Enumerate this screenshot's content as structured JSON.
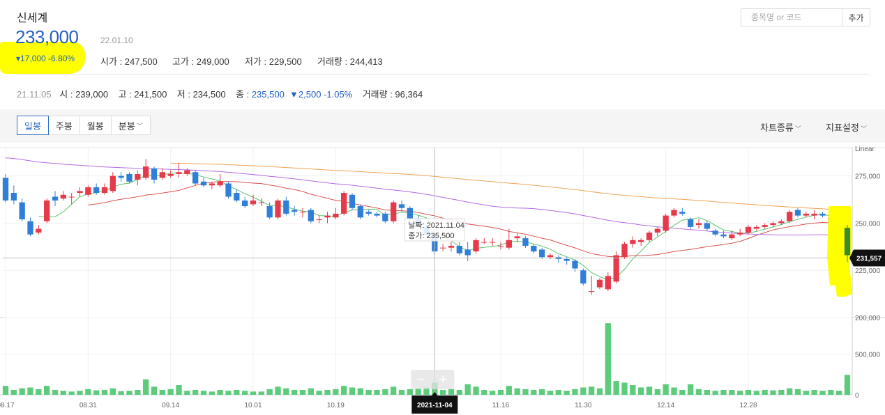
{
  "header": {
    "stock_name": "신세계",
    "price": "233,000",
    "price_date": "22.01.10",
    "change": "▾17,000 -6.80%",
    "open_label": "시가 : ",
    "open_value": "247,500",
    "high_label": "고가 : ",
    "high_value": "249,000",
    "low_label": "저가 : ",
    "low_value": "229,500",
    "volume_label": "거래량 : ",
    "volume_value": "244,413"
  },
  "search": {
    "placeholder": "종목명 or 코드",
    "add_label": "추가"
  },
  "prev_row": {
    "date": "21.11.05",
    "open_label": "시 : ",
    "open_value": "239,000",
    "high_label": "고 : ",
    "high_value": "241,500",
    "low_label": "저 : ",
    "low_value": "234,500",
    "close_label": "종 : ",
    "close_value": "235,500",
    "change": "▼2,500 -1.05%",
    "volume_label": "거래량 : ",
    "volume_value": "96,364"
  },
  "toolbar": {
    "tabs": [
      {
        "label": "일봉",
        "active": true
      },
      {
        "label": "주봉",
        "active": false
      },
      {
        "label": "월봉",
        "active": false
      },
      {
        "label": "분봉",
        "active": false,
        "dropdown": true
      }
    ],
    "chart_type_label": "차트종류",
    "indicator_label": "지표설정"
  },
  "colors": {
    "up": "#e63a4a",
    "down": "#2f7ed8",
    "volume": "#5ccc7c",
    "ma5": "#5cc46e",
    "ma20": "#d9534f",
    "ma60": "#b36ae0",
    "ma120": "#f0a356",
    "accent": "#2361c2",
    "highlight": "#ffff00",
    "last_candle": "#3a8a2f"
  },
  "chart_data": {
    "type": "candlestick",
    "scale_label": "Linear",
    "price_ticks": [
      "275,000",
      "250,000",
      "225,000",
      "200,000"
    ],
    "price_tick_values": [
      275000,
      250000,
      225000,
      200000
    ],
    "volume_ticks": [
      "500,000",
      "0"
    ],
    "volume_tick_values": [
      500000,
      0
    ],
    "x_ticks": [
      {
        "label": "08.17",
        "index": 0
      },
      {
        "label": "08.31",
        "index": 10
      },
      {
        "label": "09.14",
        "index": 20
      },
      {
        "label": "10.01",
        "index": 30
      },
      {
        "label": "10.19",
        "index": 40
      },
      {
        "label": "11.16",
        "index": 60
      },
      {
        "label": "11.30",
        "index": 70
      },
      {
        "label": "12.14",
        "index": 80
      },
      {
        "label": "12.28",
        "index": 90
      }
    ],
    "current_price_label": "231,557",
    "current_price_value": 231557,
    "crosshair": {
      "index": 52,
      "date_label": "2021-11-04",
      "tooltip_date": "날짜: 2021.11.04",
      "tooltip_close": "종가: 235,500"
    },
    "candles": [
      {
        "o": 274000,
        "c": 262000,
        "h": 276000,
        "l": 261000,
        "v": 110000
      },
      {
        "o": 266000,
        "c": 262000,
        "h": 270000,
        "l": 260000,
        "v": 60000
      },
      {
        "o": 261000,
        "c": 252000,
        "h": 263000,
        "l": 251000,
        "v": 80000
      },
      {
        "o": 251000,
        "c": 244000,
        "h": 253000,
        "l": 243000,
        "v": 90000
      },
      {
        "o": 245000,
        "c": 247000,
        "h": 249000,
        "l": 244000,
        "v": 70000
      },
      {
        "o": 251000,
        "c": 262000,
        "h": 263000,
        "l": 250000,
        "v": 110000
      },
      {
        "o": 264000,
        "c": 262000,
        "h": 267000,
        "l": 259000,
        "v": 60000
      },
      {
        "o": 263000,
        "c": 265000,
        "h": 267000,
        "l": 262000,
        "v": 50000
      },
      {
        "o": 264000,
        "c": 264000,
        "h": 266000,
        "l": 260000,
        "v": 40000
      },
      {
        "o": 266000,
        "c": 267000,
        "h": 269000,
        "l": 264000,
        "v": 50000
      },
      {
        "o": 265000,
        "c": 269000,
        "h": 270000,
        "l": 264000,
        "v": 70000
      },
      {
        "o": 269000,
        "c": 266000,
        "h": 271000,
        "l": 265000,
        "v": 55000
      },
      {
        "o": 266000,
        "c": 269000,
        "h": 271000,
        "l": 265000,
        "v": 60000
      },
      {
        "o": 267000,
        "c": 275000,
        "h": 277000,
        "l": 266000,
        "v": 80000
      },
      {
        "o": 275000,
        "c": 274000,
        "h": 277000,
        "l": 272000,
        "v": 45000
      },
      {
        "o": 276000,
        "c": 272000,
        "h": 277000,
        "l": 271000,
        "v": 50000
      },
      {
        "o": 273000,
        "c": 276000,
        "h": 278000,
        "l": 270000,
        "v": 60000
      },
      {
        "o": 274000,
        "c": 280000,
        "h": 284000,
        "l": 273000,
        "v": 190000
      },
      {
        "o": 279000,
        "c": 273000,
        "h": 280000,
        "l": 271000,
        "v": 100000
      },
      {
        "o": 274000,
        "c": 277000,
        "h": 279000,
        "l": 273000,
        "v": 60000
      },
      {
        "o": 275000,
        "c": 276000,
        "h": 278000,
        "l": 274000,
        "v": 70000
      },
      {
        "o": 276000,
        "c": 277000,
        "h": 282000,
        "l": 274000,
        "v": 120000
      },
      {
        "o": 276000,
        "c": 278000,
        "h": 279000,
        "l": 275000,
        "v": 50000
      },
      {
        "o": 277000,
        "c": 271000,
        "h": 278000,
        "l": 270000,
        "v": 60000
      },
      {
        "o": 272000,
        "c": 270000,
        "h": 274000,
        "l": 269000,
        "v": 50000
      },
      {
        "o": 270000,
        "c": 271000,
        "h": 272000,
        "l": 268000,
        "v": 40000
      },
      {
        "o": 270000,
        "c": 272000,
        "h": 276000,
        "l": 269000,
        "v": 60000
      },
      {
        "o": 271000,
        "c": 264000,
        "h": 272000,
        "l": 263000,
        "v": 50000
      },
      {
        "o": 266000,
        "c": 262000,
        "h": 268000,
        "l": 261000,
        "v": 60000
      },
      {
        "o": 262000,
        "c": 259000,
        "h": 264000,
        "l": 258000,
        "v": 50000
      },
      {
        "o": 260000,
        "c": 262000,
        "h": 265000,
        "l": 259000,
        "v": 40000
      },
      {
        "o": 261000,
        "c": 261000,
        "h": 263000,
        "l": 259000,
        "v": 40000
      },
      {
        "o": 259000,
        "c": 253000,
        "h": 261000,
        "l": 252000,
        "v": 70000
      },
      {
        "o": 253000,
        "c": 262000,
        "h": 263000,
        "l": 252000,
        "v": 100000
      },
      {
        "o": 262000,
        "c": 255000,
        "h": 264000,
        "l": 254000,
        "v": 80000
      },
      {
        "o": 257000,
        "c": 256000,
        "h": 259000,
        "l": 254000,
        "v": 60000
      },
      {
        "o": 256000,
        "c": 256000,
        "h": 258000,
        "l": 253000,
        "v": 60000
      },
      {
        "o": 257000,
        "c": 251000,
        "h": 258000,
        "l": 250000,
        "v": 80000
      },
      {
        "o": 252000,
        "c": 252000,
        "h": 254000,
        "l": 250000,
        "v": 50000
      },
      {
        "o": 253000,
        "c": 254000,
        "h": 256000,
        "l": 250000,
        "v": 60000
      },
      {
        "o": 253000,
        "c": 255000,
        "h": 258000,
        "l": 252000,
        "v": 70000
      },
      {
        "o": 255000,
        "c": 266000,
        "h": 267000,
        "l": 254000,
        "v": 110000
      },
      {
        "o": 265000,
        "c": 258000,
        "h": 266000,
        "l": 257000,
        "v": 90000
      },
      {
        "o": 259000,
        "c": 253000,
        "h": 260000,
        "l": 252000,
        "v": 80000
      },
      {
        "o": 256000,
        "c": 255000,
        "h": 257000,
        "l": 254000,
        "v": 60000
      },
      {
        "o": 255000,
        "c": 254000,
        "h": 256000,
        "l": 253000,
        "v": 60000
      },
      {
        "o": 255000,
        "c": 251000,
        "h": 256000,
        "l": 250000,
        "v": 70000
      },
      {
        "o": 251000,
        "c": 261000,
        "h": 262000,
        "l": 250000,
        "v": 100000
      },
      {
        "o": 260000,
        "c": 258000,
        "h": 262000,
        "l": 256000,
        "v": 60000
      },
      {
        "o": 258000,
        "c": 252000,
        "h": 259000,
        "l": 251000,
        "v": 70000
      },
      {
        "o": 252000,
        "c": 249000,
        "h": 254000,
        "l": 248000,
        "v": 80000
      },
      {
        "o": 248000,
        "c": 244000,
        "h": 249000,
        "l": 243000,
        "v": 90000
      },
      {
        "o": 244000,
        "c": 235000,
        "h": 246000,
        "l": 233000,
        "v": 150000
      },
      {
        "o": 237000,
        "c": 237000,
        "h": 239000,
        "l": 235000,
        "v": 60000
      },
      {
        "o": 237000,
        "c": 238000,
        "h": 240000,
        "l": 235000,
        "v": 70000
      },
      {
        "o": 238000,
        "c": 234000,
        "h": 240000,
        "l": 233000,
        "v": 60000
      },
      {
        "o": 236000,
        "c": 233000,
        "h": 240000,
        "l": 230000,
        "v": 130000
      },
      {
        "o": 235000,
        "c": 241000,
        "h": 242000,
        "l": 234000,
        "v": 100000
      },
      {
        "o": 240000,
        "c": 240000,
        "h": 242000,
        "l": 239000,
        "v": 60000
      },
      {
        "o": 240000,
        "c": 240000,
        "h": 242000,
        "l": 238000,
        "v": 50000
      },
      {
        "o": 238000,
        "c": 238000,
        "h": 240000,
        "l": 236000,
        "v": 60000
      },
      {
        "o": 237000,
        "c": 241000,
        "h": 247000,
        "l": 236000,
        "v": 110000
      },
      {
        "o": 242000,
        "c": 243000,
        "h": 245000,
        "l": 240000,
        "v": 80000
      },
      {
        "o": 242000,
        "c": 238000,
        "h": 243000,
        "l": 237000,
        "v": 70000
      },
      {
        "o": 238000,
        "c": 235000,
        "h": 239000,
        "l": 234000,
        "v": 60000
      },
      {
        "o": 236000,
        "c": 232000,
        "h": 237000,
        "l": 231000,
        "v": 70000
      },
      {
        "o": 232000,
        "c": 233000,
        "h": 234000,
        "l": 231000,
        "v": 50000
      },
      {
        "o": 232000,
        "c": 231000,
        "h": 233000,
        "l": 229000,
        "v": 60000
      },
      {
        "o": 231000,
        "c": 230000,
        "h": 232000,
        "l": 228000,
        "v": 50000
      },
      {
        "o": 230000,
        "c": 226000,
        "h": 231000,
        "l": 224000,
        "v": 70000
      },
      {
        "o": 225000,
        "c": 218000,
        "h": 226000,
        "l": 217000,
        "v": 90000
      },
      {
        "o": 214000,
        "c": 214000,
        "h": 222000,
        "l": 212000,
        "v": 100000
      },
      {
        "o": 216000,
        "c": 220000,
        "h": 221000,
        "l": 215000,
        "v": 80000
      },
      {
        "o": 215000,
        "c": 222000,
        "h": 224000,
        "l": 214000,
        "v": 880000
      },
      {
        "o": 219000,
        "c": 233000,
        "h": 235000,
        "l": 218000,
        "v": 170000
      },
      {
        "o": 232000,
        "c": 239000,
        "h": 240000,
        "l": 231000,
        "v": 150000
      },
      {
        "o": 239000,
        "c": 241000,
        "h": 243000,
        "l": 237000,
        "v": 120000
      },
      {
        "o": 240000,
        "c": 241000,
        "h": 242000,
        "l": 238000,
        "v": 90000
      },
      {
        "o": 241000,
        "c": 245000,
        "h": 246000,
        "l": 240000,
        "v": 100000
      },
      {
        "o": 245000,
        "c": 247000,
        "h": 248000,
        "l": 243000,
        "v": 70000
      },
      {
        "o": 246000,
        "c": 254000,
        "h": 255000,
        "l": 245000,
        "v": 130000
      },
      {
        "o": 254000,
        "c": 257000,
        "h": 258000,
        "l": 253000,
        "v": 90000
      },
      {
        "o": 256000,
        "c": 255000,
        "h": 258000,
        "l": 254000,
        "v": 60000
      },
      {
        "o": 252000,
        "c": 248000,
        "h": 253000,
        "l": 247000,
        "v": 130000
      },
      {
        "o": 249000,
        "c": 250000,
        "h": 252000,
        "l": 247000,
        "v": 70000
      },
      {
        "o": 250000,
        "c": 247000,
        "h": 251000,
        "l": 246000,
        "v": 60000
      },
      {
        "o": 246000,
        "c": 244000,
        "h": 247000,
        "l": 243000,
        "v": 50000
      },
      {
        "o": 244000,
        "c": 243000,
        "h": 246000,
        "l": 242000,
        "v": 60000
      },
      {
        "o": 242000,
        "c": 244000,
        "h": 246000,
        "l": 241000,
        "v": 60000
      },
      {
        "o": 244000,
        "c": 245000,
        "h": 247000,
        "l": 243000,
        "v": 50000
      },
      {
        "o": 245000,
        "c": 248000,
        "h": 249000,
        "l": 244000,
        "v": 60000
      },
      {
        "o": 247000,
        "c": 248000,
        "h": 249000,
        "l": 246000,
        "v": 50000
      },
      {
        "o": 248000,
        "c": 249000,
        "h": 250000,
        "l": 247000,
        "v": 60000
      },
      {
        "o": 249000,
        "c": 250000,
        "h": 251000,
        "l": 248000,
        "v": 55000
      },
      {
        "o": 250000,
        "c": 251000,
        "h": 252000,
        "l": 249000,
        "v": 60000
      },
      {
        "o": 251000,
        "c": 256000,
        "h": 257000,
        "l": 250000,
        "v": 80000
      },
      {
        "o": 257000,
        "c": 254000,
        "h": 258000,
        "l": 253000,
        "v": 70000
      },
      {
        "o": 254000,
        "c": 255000,
        "h": 256000,
        "l": 253000,
        "v": 50000
      },
      {
        "o": 254000,
        "c": 255000,
        "h": 257000,
        "l": 252000,
        "v": 60000
      },
      {
        "o": 255000,
        "c": 254000,
        "h": 256000,
        "l": 253000,
        "v": 50000
      },
      {
        "o": 253000,
        "c": 250000,
        "h": 254000,
        "l": 249000,
        "v": 60000
      },
      {
        "o": 250000,
        "c": 251000,
        "h": 252000,
        "l": 249000,
        "v": 50000
      },
      {
        "o": 247500,
        "c": 233000,
        "h": 249000,
        "l": 229500,
        "v": 244413
      }
    ],
    "moving_averages": [
      {
        "period": 5,
        "color": "#5cc46e",
        "start": 4
      },
      {
        "period": 20,
        "color": "#d9534f",
        "start": 10
      },
      {
        "period": 60,
        "color": "#b36ae0",
        "start": 0,
        "seed": 285000
      },
      {
        "period": 120,
        "color": "#f0a356",
        "start": 20,
        "seed": 285000
      }
    ]
  }
}
